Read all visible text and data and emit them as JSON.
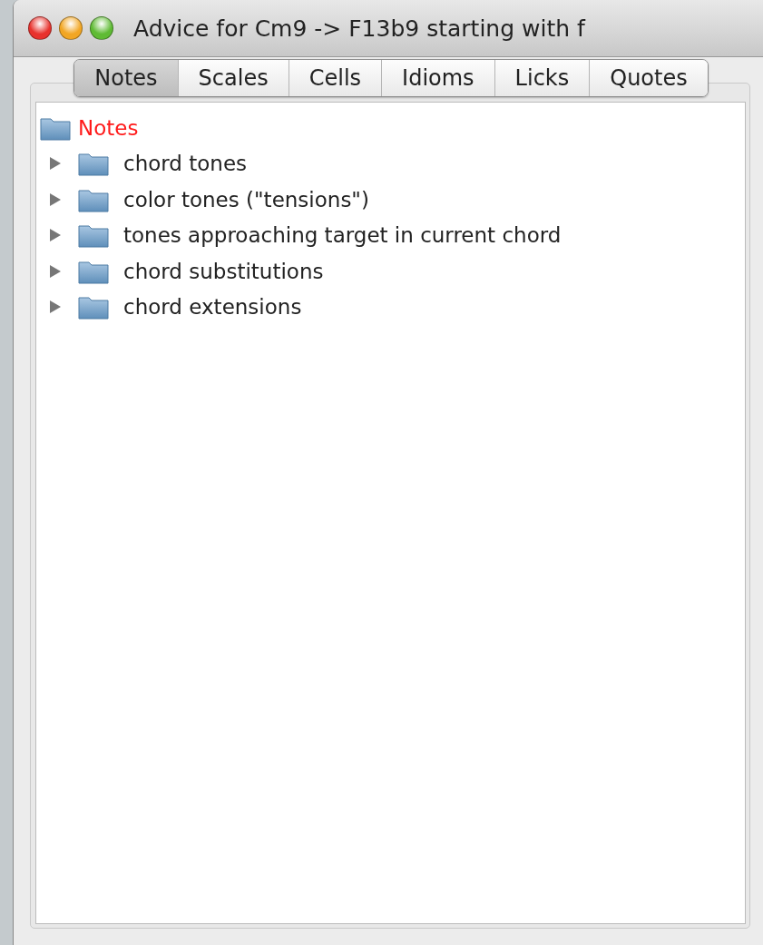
{
  "window": {
    "title": "Advice for Cm9 -> F13b9 starting with f"
  },
  "tabs": [
    {
      "label": "Notes",
      "selected": true
    },
    {
      "label": "Scales",
      "selected": false
    },
    {
      "label": "Cells",
      "selected": false
    },
    {
      "label": "Idioms",
      "selected": false
    },
    {
      "label": "Licks",
      "selected": false
    },
    {
      "label": "Quotes",
      "selected": false
    }
  ],
  "tree": {
    "label": "Notes",
    "selected": true,
    "children": [
      {
        "label": "chord tones",
        "expanded": false
      },
      {
        "label": "color tones (\"tensions\")",
        "expanded": false
      },
      {
        "label": "tones approaching target in current chord",
        "expanded": false
      },
      {
        "label": "chord substitutions",
        "expanded": false
      },
      {
        "label": "chord extensions",
        "expanded": false
      }
    ]
  }
}
